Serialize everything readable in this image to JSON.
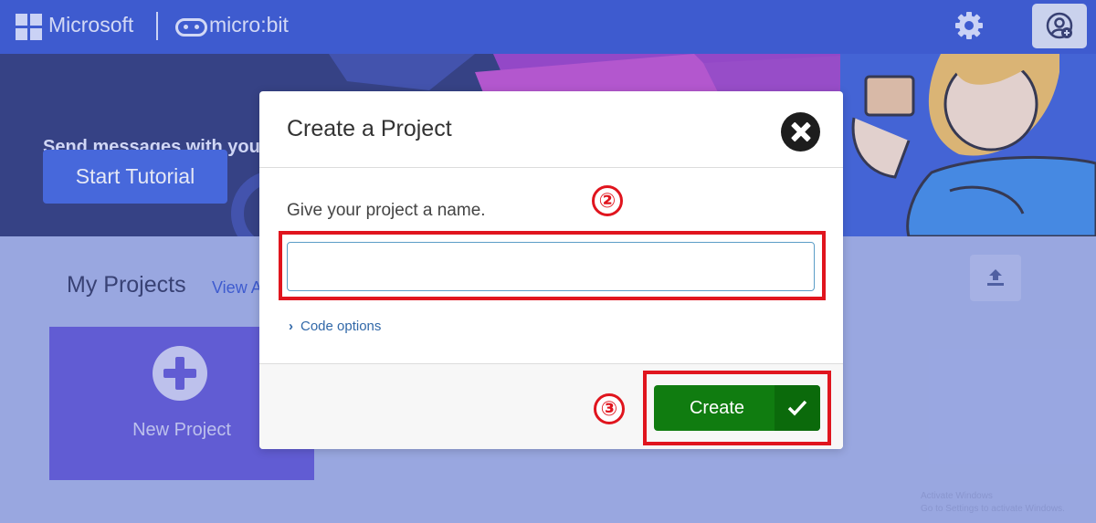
{
  "topbar": {
    "brand": "Microsoft",
    "product": "micro:bit",
    "icons": [
      "microsoft-logo-icon",
      "microbit-logo-icon",
      "gear-icon",
      "user-add-icon"
    ]
  },
  "banner": {
    "title": "Send messages with your micro:bit",
    "tutorial_button": "Start Tutorial"
  },
  "home": {
    "section_title": "My Projects",
    "view_all": "View A",
    "new_project_label": "New Project"
  },
  "modal": {
    "title": "Create a Project",
    "prompt": "Give your project a name.",
    "name_value": "",
    "code_options": "Code options",
    "create_button": "Create"
  },
  "annotations": {
    "step_2": "②",
    "step_3": "③",
    "highlight_color": "#e0151e"
  },
  "watermark": {
    "line1": "Activate Windows",
    "line2": "Go to Settings to activate Windows."
  },
  "colors": {
    "topbar": "#3454d1",
    "banner": "#2a3577",
    "background": "#a3b0e6",
    "create_button": "#107c10",
    "new_project_tile": "#5f55d6"
  }
}
